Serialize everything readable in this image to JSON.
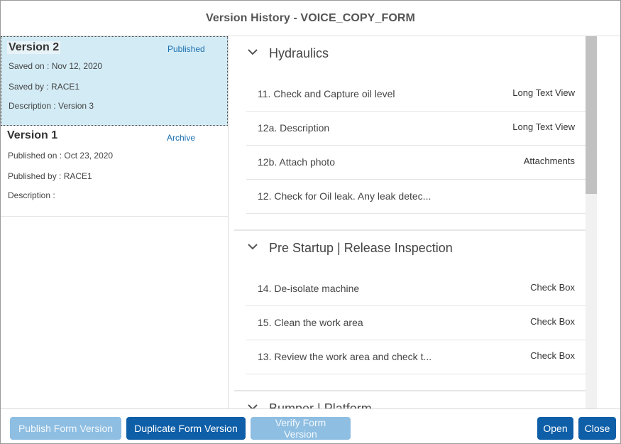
{
  "dialog": {
    "title": "Version History - VOICE_COPY_FORM"
  },
  "versions": [
    {
      "title": "Version 2",
      "status": "Published",
      "line1": "Saved on : Nov 12, 2020",
      "line2": "Saved by : RACE1",
      "line3": "Description : Version 3",
      "selected": true
    },
    {
      "title": "Version 1",
      "status": "Archive",
      "line1": "Published on : Oct 23, 2020",
      "line2": "Published by : RACE1",
      "line3": "Description :",
      "selected": false
    }
  ],
  "sections": [
    {
      "title": "Hydraulics",
      "icon": "chevron-down-icon",
      "rows": [
        {
          "label": "11. Check and Capture oil level",
          "type": "Long Text View"
        },
        {
          "label": "12a. Description",
          "type": "Long Text View"
        },
        {
          "label": "12b. Attach photo",
          "type": "Attachments"
        },
        {
          "label": "12. Check for Oil leak. Any leak detec...",
          "type": ""
        }
      ]
    },
    {
      "title": "Pre Startup | Release Inspection",
      "icon": "chevron-down-icon",
      "rows": [
        {
          "label": "14. De-isolate machine",
          "type": "Check Box"
        },
        {
          "label": "15. Clean the work area",
          "type": "Check Box"
        },
        {
          "label": "13. Review the work area and check t...",
          "type": "Check Box"
        }
      ]
    },
    {
      "title": "Bumper | Platform",
      "icon": "chevron-down-icon",
      "rows": []
    }
  ],
  "footer": {
    "publish_label": "Publish Form Version",
    "duplicate_label": "Duplicate Form Version",
    "verify_label": "Verify Form Version",
    "open_label": "Open",
    "close_label": "Close"
  },
  "colors": {
    "primary": "#0e5fa8",
    "disabled": "#8ebee2",
    "selected_bg": "#d3ebf5",
    "status_link": "#1a6fb0"
  }
}
